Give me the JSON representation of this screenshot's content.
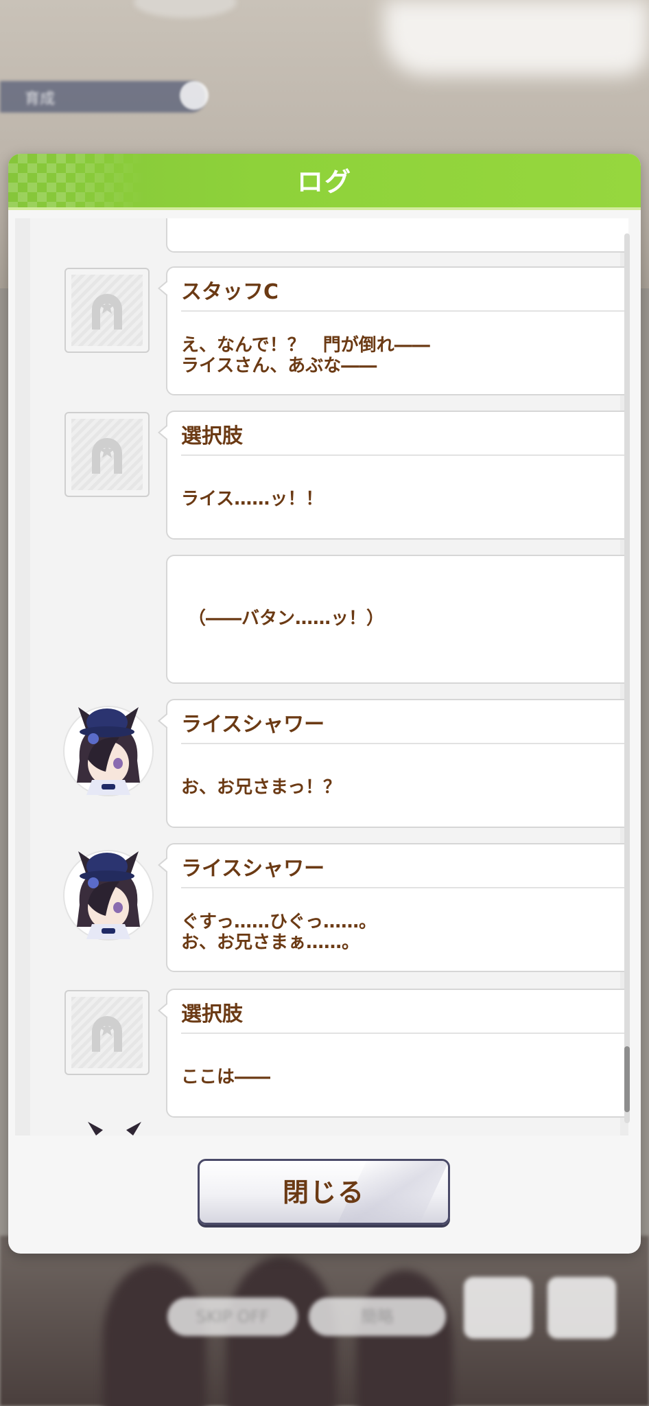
{
  "background": {
    "hud_name": "育成",
    "skip_label": "SKIP OFF",
    "auto_label": "簡略"
  },
  "modal": {
    "title": "ログ",
    "close_label": "閉じる"
  },
  "colors": {
    "header_green": "#8ed23a",
    "text_brown": "#6b3a14",
    "bubble_border": "#d6d6d6",
    "button_border": "#4a4a68"
  },
  "log": [
    {
      "icon": "horseshoe-placeholder-icon",
      "speaker": "スタッフC",
      "text": "え、なんで！？　門が倒れ――\nライスさん、あぶな――"
    },
    {
      "icon": "horseshoe-placeholder-icon",
      "speaker": "選択肢",
      "text": "ライス……ッ！！"
    },
    {
      "icon": "",
      "speaker": "",
      "text": "（――バタン……ッ！）"
    },
    {
      "icon": "rice-shower-avatar",
      "speaker": "ライスシャワー",
      "text": "お、お兄さまっ！？"
    },
    {
      "icon": "rice-shower-avatar",
      "speaker": "ライスシャワー",
      "text": "ぐすっ……ひぐっ……。\nお、お兄さまぁ……。"
    },
    {
      "icon": "horseshoe-placeholder-icon",
      "speaker": "選択肢",
      "text": "ここは――"
    }
  ]
}
